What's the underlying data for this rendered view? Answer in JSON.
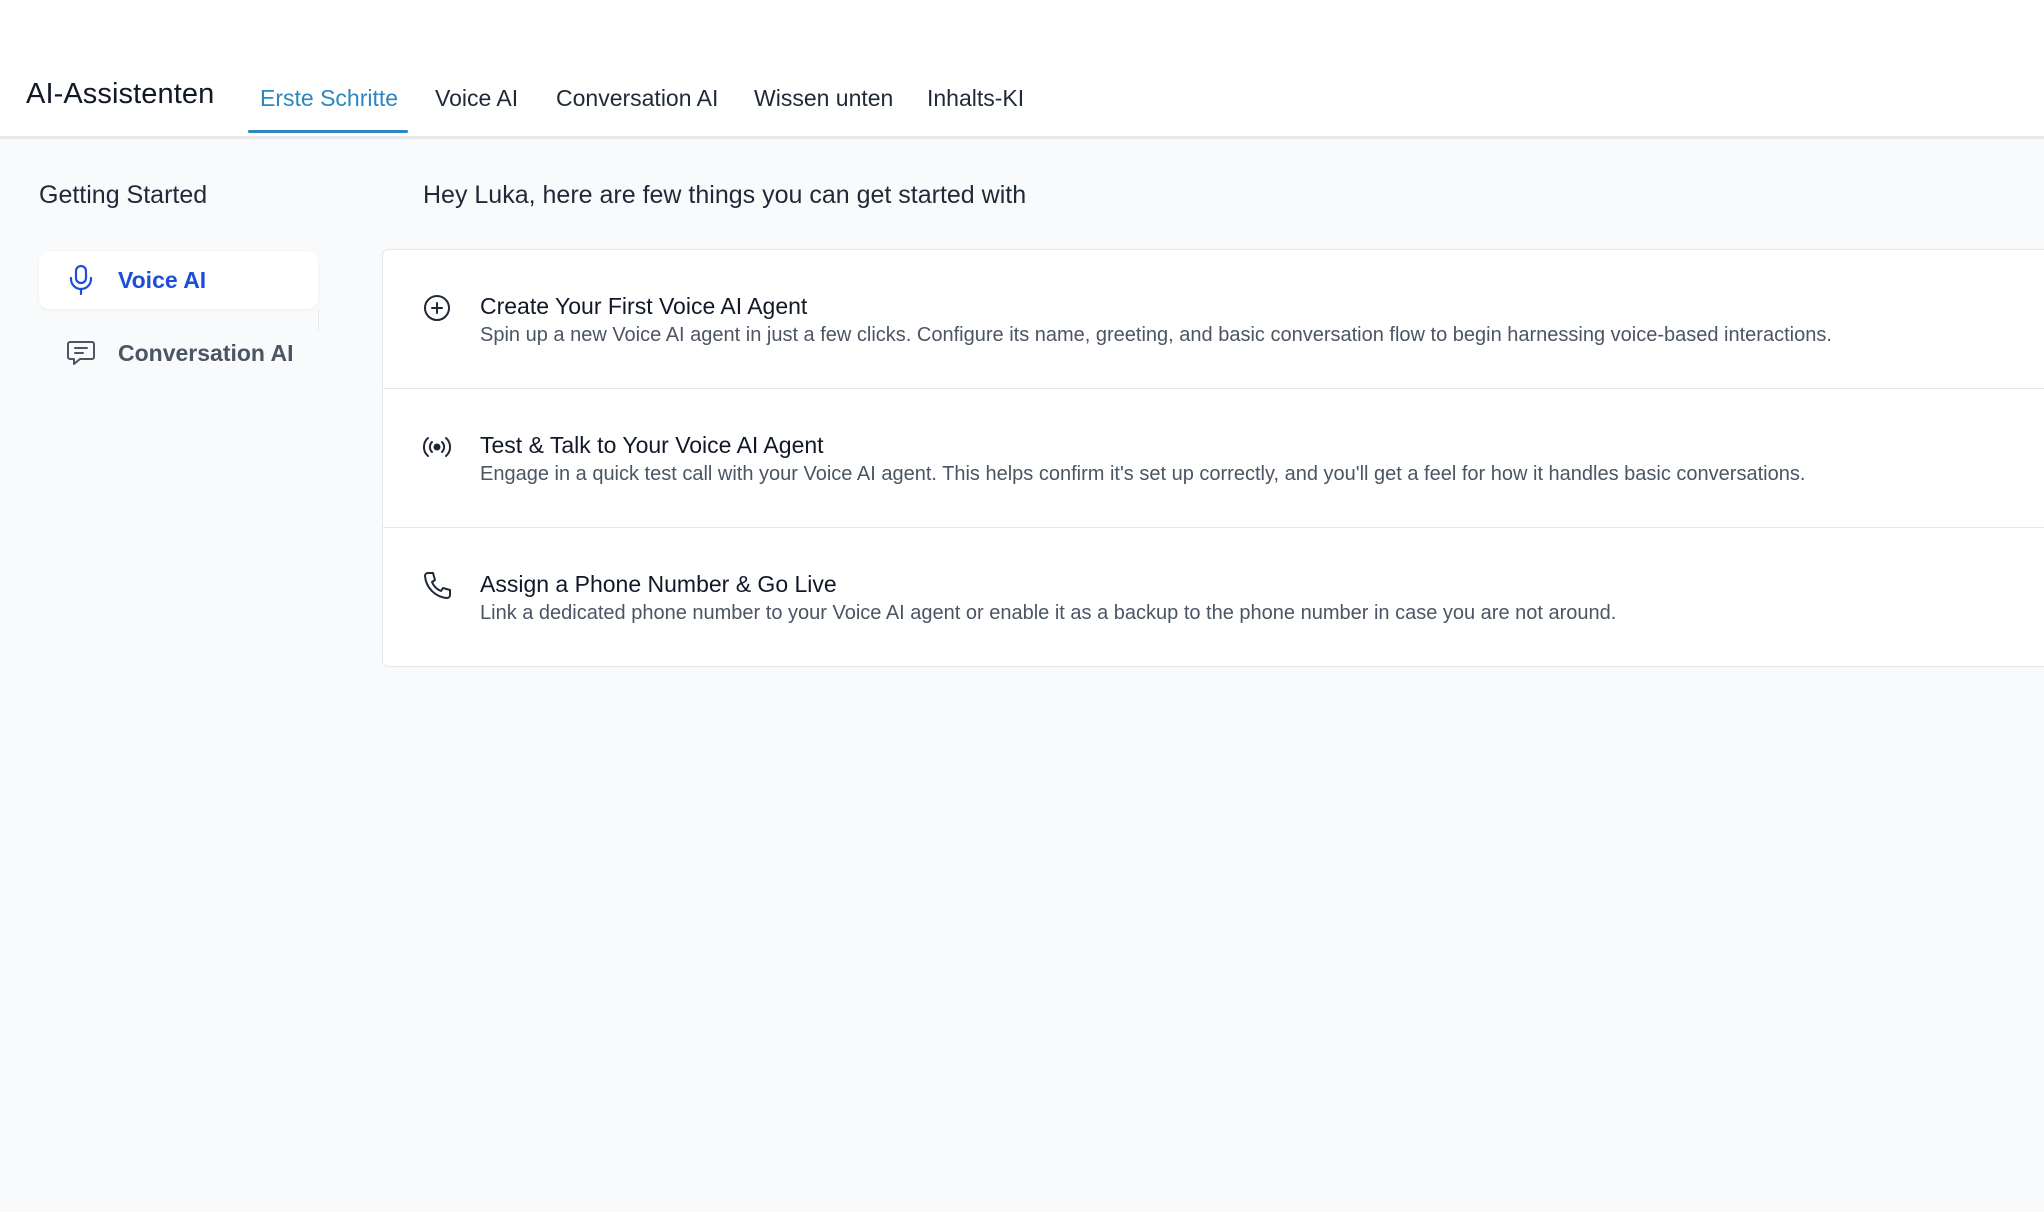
{
  "header": {
    "app_title": "AI-Assistenten",
    "tabs": [
      {
        "label": "Erste Schritte",
        "active": true
      },
      {
        "label": "Voice AI",
        "active": false
      },
      {
        "label": "Conversation AI",
        "active": false
      },
      {
        "label": "Wissen unten",
        "active": false
      },
      {
        "label": "Inhalts-KI",
        "active": false
      }
    ]
  },
  "sidebar": {
    "title": "Getting Started",
    "items": [
      {
        "label": "Voice AI",
        "icon": "microphone-icon",
        "active": true
      },
      {
        "label": "Conversation AI",
        "icon": "chat-icon",
        "active": false
      }
    ]
  },
  "main": {
    "greeting": "Hey Luka, here are few things you can get started with",
    "steps": [
      {
        "icon": "plus-circle-icon",
        "title": "Create Your First Voice AI Agent",
        "description": "Spin up a new Voice AI agent in just a few clicks. Configure its name, greeting, and basic conversation flow to begin harnessing voice-based interactions."
      },
      {
        "icon": "broadcast-icon",
        "title": "Test & Talk to Your Voice AI Agent",
        "description": "Engage in a quick test call with your Voice AI agent. This helps confirm it's set up correctly, and you'll get a feel for how it handles basic conversations."
      },
      {
        "icon": "phone-icon",
        "title": "Assign a Phone Number & Go Live",
        "description": "Link a dedicated phone number to your Voice AI agent or enable it as a backup to the phone number in case you are not around."
      }
    ]
  },
  "colors": {
    "accent_tab": "#2e86c1",
    "sidebar_active": "#1d4ed8",
    "background": "#f9fafb"
  }
}
